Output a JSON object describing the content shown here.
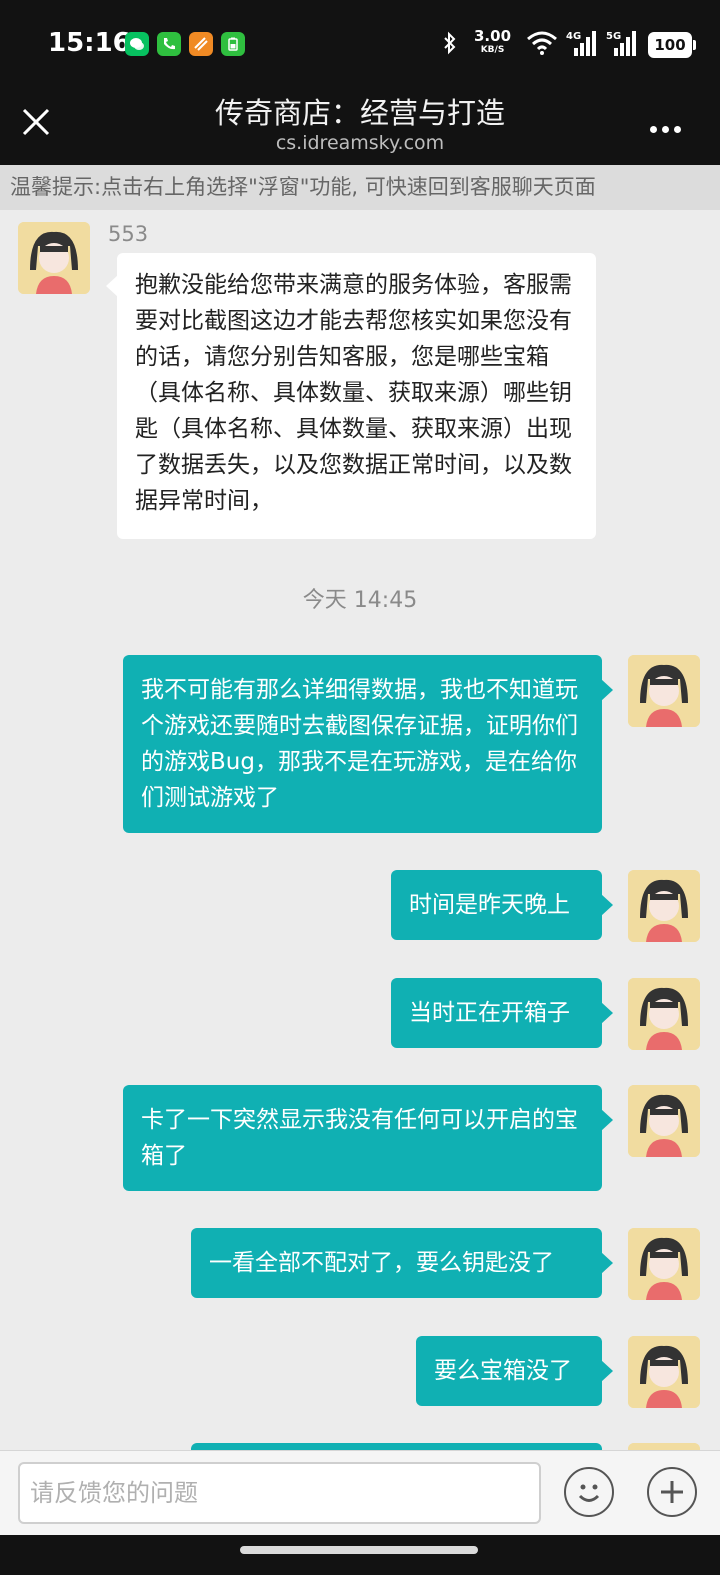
{
  "status_bar": {
    "time": "15:16",
    "network_speed_value": "3.00",
    "network_speed_unit": "KB/S",
    "battery": "100",
    "icons": [
      "wechat-icon",
      "phone-icon",
      "app-icon",
      "battery-app-icon",
      "bluetooth-icon",
      "wifi-icon",
      "signal-4g-icon",
      "signal-5g-icon"
    ]
  },
  "navbar": {
    "title": "传奇商店：经营与打造",
    "subtitle": "cs.idreamsky.com"
  },
  "tip": "温馨提示:点击右上角选择\"浮窗\"功能, 可快速回到客服聊天页面",
  "chat": {
    "agent_name": "553",
    "agent_message": "抱歉没能给您带来满意的服务体验，客服需要对比截图这边才能去帮您核实如果您没有的话，请您分别告知客服，您是哪些宝箱（具体名称、具体数量、获取来源）哪些钥匙（具体名称、具体数量、获取来源）出现了数据丢失，以及您数据正常时间，以及数据异常时间，",
    "time_separator": "今天 14:45",
    "user_messages": [
      "我不可能有那么详细得数据，我也不知道玩个游戏还要随时去截图保存证据，证明你们的游戏Bug，那我不是在玩游戏，是在给你们测试游戏了",
      "时间是昨天晚上",
      "当时正在开箱子",
      "卡了一下突然显示我没有任何可以开启的宝箱了",
      "一看全部不配对了，要么钥匙没了",
      "要么宝箱没了"
    ]
  },
  "input": {
    "placeholder": "请反馈您的问题"
  },
  "colors": {
    "accent": "#10b0b3",
    "dark": "#121212",
    "chat_bg": "#ececec"
  }
}
